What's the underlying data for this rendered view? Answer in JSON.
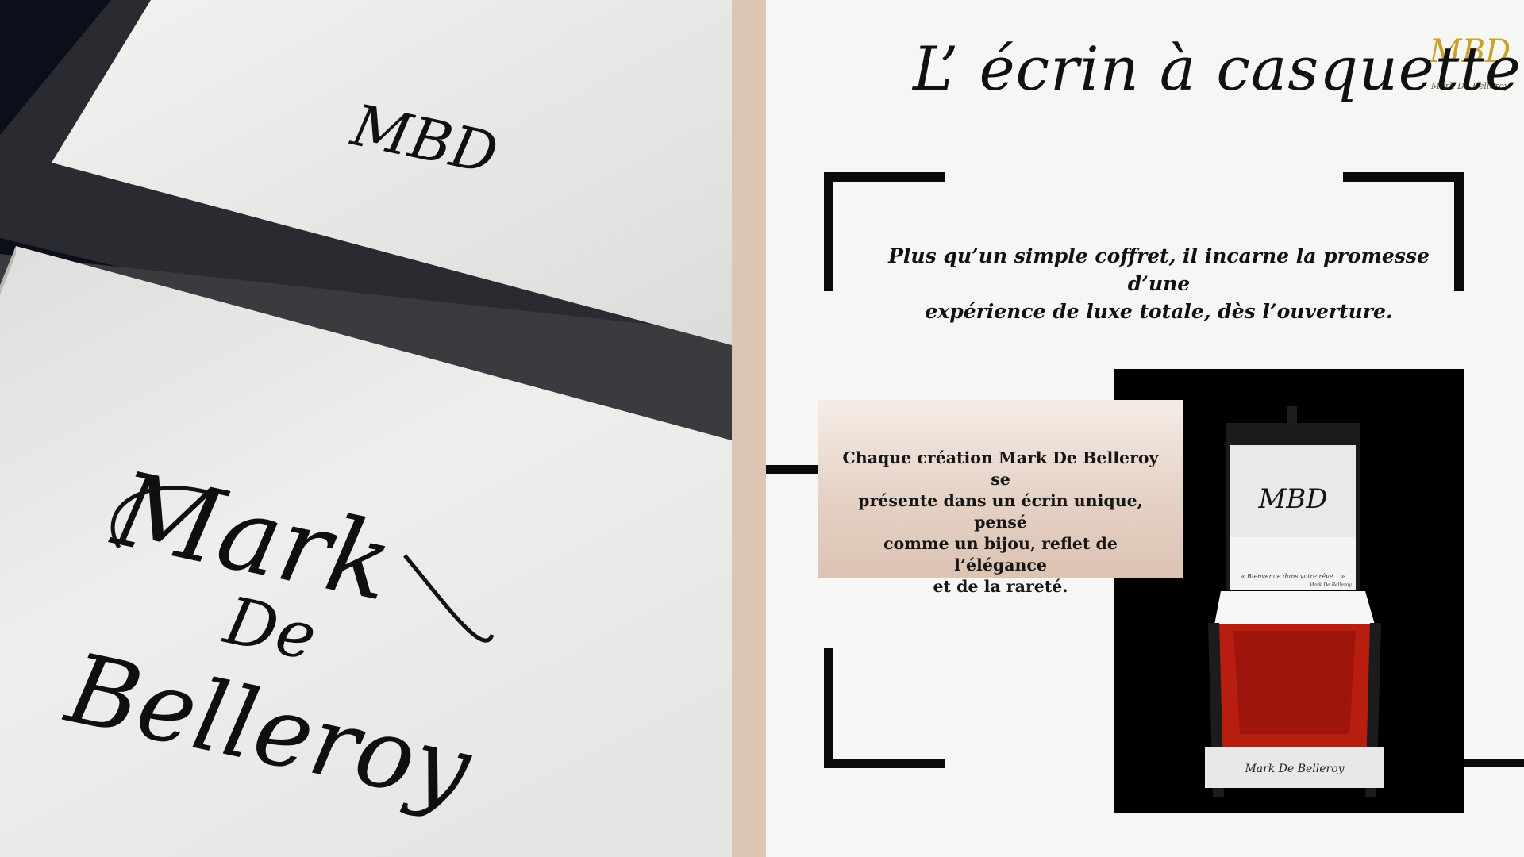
{
  "title": "L’ écrin à casquette",
  "intro": {
    "line1": "Plus qu’un simple coffret, il incarne la promesse d’une",
    "line2": "expérience de luxe totale, dès l’ouverture."
  },
  "description": {
    "line1": "Chaque création Mark De Belleroy se",
    "line2": "présente dans un écrin unique, pensé",
    "line3": "comme un bijou, reflet de l’élégance",
    "line4": "et de la rareté."
  },
  "brand": {
    "monogram": "MBD",
    "name": "Mark De Belleroy"
  },
  "photo": {
    "lid_monogram": "MBD",
    "script_line1": "Mark",
    "script_line2": "De",
    "script_line3": "Belleroy"
  },
  "product": {
    "monogram": "MBD",
    "welcome_text": "« Bienvenue dans votre rêve... »",
    "signature": "Mark De Belleroy",
    "front_label": "Mark De Belleroy"
  },
  "colors": {
    "beige": "#dcc5b5",
    "gold": "#c9a227",
    "black": "#0b0b0b",
    "interior_red": "#b81e10"
  }
}
